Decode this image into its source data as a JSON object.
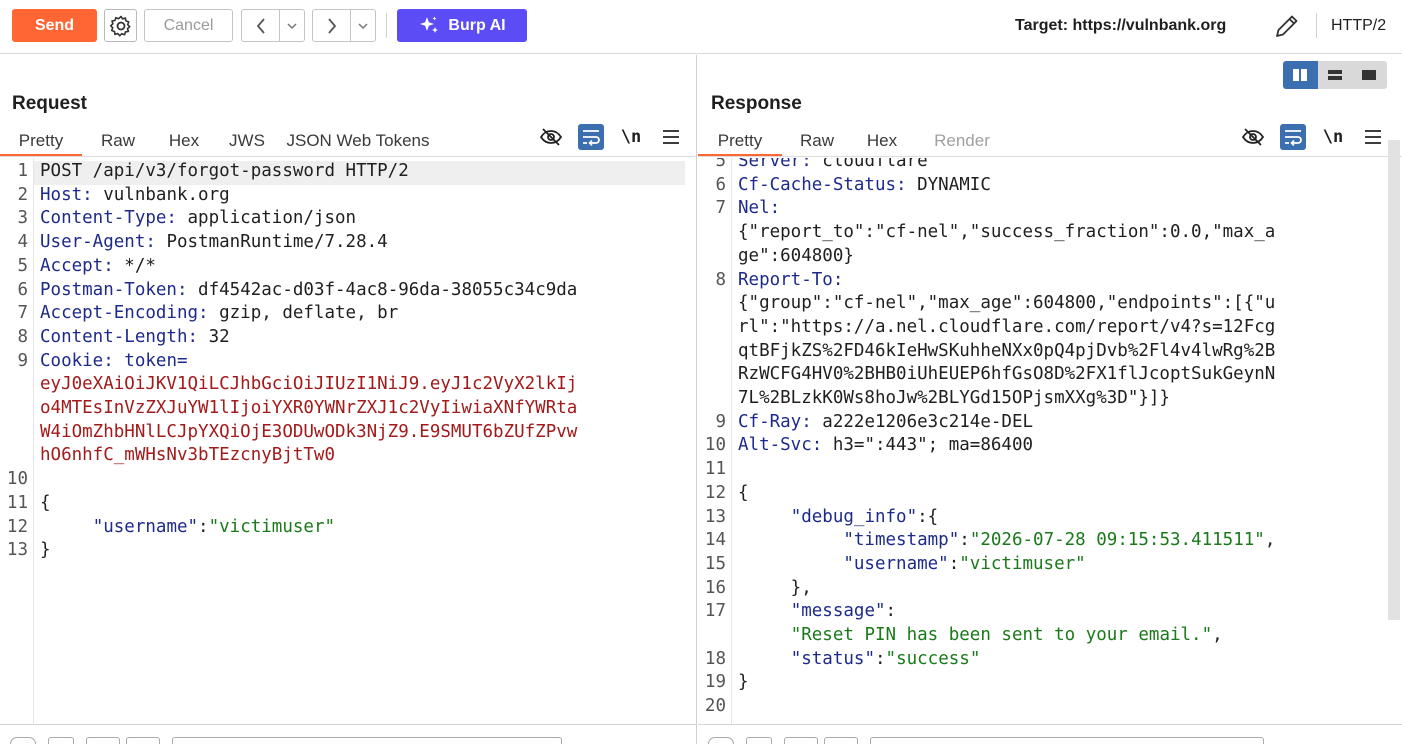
{
  "toolbar": {
    "send_label": "Send",
    "cancel_label": "Cancel",
    "burp_ai_label": "Burp AI",
    "target_text": "Target: https://vulnbank.org",
    "protocol": "HTTP/2",
    "colors": {
      "send": "#ff6633",
      "burp_ai": "#5b4cf5"
    }
  },
  "request": {
    "title": "Request",
    "tabs": [
      "Pretty",
      "Raw",
      "Hex",
      "JWS",
      "JSON Web Tokens"
    ],
    "active_tab": "Pretty",
    "lines": [
      {
        "n": "1",
        "parts": [
          {
            "t": "POST /api/v3/forgot-password HTTP/2",
            "c": ""
          }
        ]
      },
      {
        "n": "2",
        "parts": [
          {
            "t": "Host:",
            "c": "k"
          },
          {
            "t": " vulnbank.org",
            "c": ""
          }
        ]
      },
      {
        "n": "3",
        "parts": [
          {
            "t": "Content-Type:",
            "c": "k"
          },
          {
            "t": " application/json",
            "c": ""
          }
        ]
      },
      {
        "n": "4",
        "parts": [
          {
            "t": "User-Agent:",
            "c": "k"
          },
          {
            "t": " PostmanRuntime/7.28.4",
            "c": ""
          }
        ]
      },
      {
        "n": "5",
        "parts": [
          {
            "t": "Accept:",
            "c": "k"
          },
          {
            "t": " */*",
            "c": ""
          }
        ]
      },
      {
        "n": "6",
        "parts": [
          {
            "t": "Postman-Token:",
            "c": "k"
          },
          {
            "t": " df4542ac-d03f-4ac8-96da-38055c34c9da",
            "c": ""
          }
        ]
      },
      {
        "n": "7",
        "parts": [
          {
            "t": "Accept-Encoding:",
            "c": "k"
          },
          {
            "t": " gzip, deflate, br",
            "c": ""
          }
        ]
      },
      {
        "n": "8",
        "parts": [
          {
            "t": "Content-Length:",
            "c": "k"
          },
          {
            "t": " 32",
            "c": ""
          }
        ]
      },
      {
        "n": "9",
        "parts": [
          {
            "t": "Cookie:",
            "c": "k"
          },
          {
            "t": " token=",
            "c": "k"
          }
        ]
      },
      {
        "n": "",
        "parts": [
          {
            "t": "eyJ0eXAiOiJKV1QiLCJhbGciOiJIUzI1NiJ9.eyJ1c2VyX2lkIj",
            "c": "tok"
          }
        ]
      },
      {
        "n": "",
        "parts": [
          {
            "t": "o4MTEsInVzZXJuYW1lIjoiYXR0YWNrZXJ1c2VyIiwiaXNfYWRta",
            "c": "tok"
          }
        ]
      },
      {
        "n": "",
        "parts": [
          {
            "t": "W4iOmZhbHNlLCJpYXQiOjE3ODUwODk3NjZ9.E9SMUT6bZUfZPvw",
            "c": "tok"
          }
        ]
      },
      {
        "n": "",
        "parts": [
          {
            "t": "hO6nhfC_mWHsNv3bTEzcnyBjtTw0",
            "c": "tok"
          }
        ]
      },
      {
        "n": "10",
        "parts": [
          {
            "t": "",
            "c": ""
          }
        ]
      },
      {
        "n": "11",
        "parts": [
          {
            "t": "{",
            "c": ""
          }
        ]
      },
      {
        "n": "12",
        "parts": [
          {
            "t": "     ",
            "c": ""
          },
          {
            "t": "\"username\"",
            "c": "k"
          },
          {
            "t": ":",
            "c": ""
          },
          {
            "t": "\"victimuser\"",
            "c": "s"
          }
        ]
      },
      {
        "n": "13",
        "parts": [
          {
            "t": "}",
            "c": ""
          }
        ]
      }
    ]
  },
  "response": {
    "title": "Response",
    "tabs": [
      "Pretty",
      "Raw",
      "Hex",
      "Render"
    ],
    "active_tab": "Pretty",
    "lines": [
      {
        "n": "5",
        "parts": [
          {
            "t": "Server:",
            "c": "k"
          },
          {
            "t": " cloudflare",
            "c": ""
          }
        ]
      },
      {
        "n": "6",
        "parts": [
          {
            "t": "Cf-Cache-Status:",
            "c": "k"
          },
          {
            "t": " DYNAMIC",
            "c": ""
          }
        ]
      },
      {
        "n": "7",
        "parts": [
          {
            "t": "Nel:",
            "c": "k"
          }
        ]
      },
      {
        "n": "",
        "parts": [
          {
            "t": "{\"report_to\":\"cf-nel\",\"success_fraction\":0.0,\"max_a",
            "c": ""
          }
        ]
      },
      {
        "n": "",
        "parts": [
          {
            "t": "ge\":604800}",
            "c": ""
          }
        ]
      },
      {
        "n": "8",
        "parts": [
          {
            "t": "Report-To:",
            "c": "k"
          }
        ]
      },
      {
        "n": "",
        "parts": [
          {
            "t": "{\"group\":\"cf-nel\",\"max_age\":604800,\"endpoints\":[{\"u",
            "c": ""
          }
        ]
      },
      {
        "n": "",
        "parts": [
          {
            "t": "rl\":\"https://a.nel.cloudflare.com/report/v4?s=12Fcg",
            "c": ""
          }
        ]
      },
      {
        "n": "",
        "parts": [
          {
            "t": "qtBFjkZS%2FD46kIeHwSKuhheNXx0pQ4pjDvb%2Fl4v4lwRg%2B",
            "c": ""
          }
        ]
      },
      {
        "n": "",
        "parts": [
          {
            "t": "RzWCFG4HV0%2BHB0iUhEUEP6hfGsO8D%2FX1flJcoptSukGeynN",
            "c": ""
          }
        ]
      },
      {
        "n": "",
        "parts": [
          {
            "t": "7L%2BLzkK0Ws8hoJw%2BLYGd15OPjsmXXg%3D\"}]}",
            "c": ""
          }
        ]
      },
      {
        "n": "9",
        "parts": [
          {
            "t": "Cf-Ray:",
            "c": "k"
          },
          {
            "t": " a222e1206e3c214e-DEL",
            "c": ""
          }
        ]
      },
      {
        "n": "10",
        "parts": [
          {
            "t": "Alt-Svc:",
            "c": "k"
          },
          {
            "t": " h3=\":443\"; ma=86400",
            "c": ""
          }
        ]
      },
      {
        "n": "11",
        "parts": [
          {
            "t": "",
            "c": ""
          }
        ]
      },
      {
        "n": "12",
        "parts": [
          {
            "t": "{",
            "c": ""
          }
        ]
      },
      {
        "n": "13",
        "parts": [
          {
            "t": "     ",
            "c": ""
          },
          {
            "t": "\"debug_info\"",
            "c": "k"
          },
          {
            "t": ":{",
            "c": ""
          }
        ]
      },
      {
        "n": "14",
        "parts": [
          {
            "t": "          ",
            "c": ""
          },
          {
            "t": "\"timestamp\"",
            "c": "k"
          },
          {
            "t": ":",
            "c": ""
          },
          {
            "t": "\"2026-07-28 09:15:53.411511\"",
            "c": "s"
          },
          {
            "t": ",",
            "c": ""
          }
        ]
      },
      {
        "n": "15",
        "parts": [
          {
            "t": "          ",
            "c": ""
          },
          {
            "t": "\"username\"",
            "c": "k"
          },
          {
            "t": ":",
            "c": ""
          },
          {
            "t": "\"victimuser\"",
            "c": "s"
          }
        ]
      },
      {
        "n": "16",
        "parts": [
          {
            "t": "     },",
            "c": ""
          }
        ]
      },
      {
        "n": "17",
        "parts": [
          {
            "t": "     ",
            "c": ""
          },
          {
            "t": "\"message\"",
            "c": "k"
          },
          {
            "t": ":",
            "c": ""
          }
        ]
      },
      {
        "n": "",
        "parts": [
          {
            "t": "     ",
            "c": ""
          },
          {
            "t": "\"Reset PIN has been sent to your email.\"",
            "c": "s"
          },
          {
            "t": ",",
            "c": ""
          }
        ]
      },
      {
        "n": "18",
        "parts": [
          {
            "t": "     ",
            "c": ""
          },
          {
            "t": "\"status\"",
            "c": "k"
          },
          {
            "t": ":",
            "c": ""
          },
          {
            "t": "\"success\"",
            "c": "s"
          }
        ]
      },
      {
        "n": "19",
        "parts": [
          {
            "t": "}",
            "c": ""
          }
        ]
      },
      {
        "n": "20",
        "parts": [
          {
            "t": "",
            "c": ""
          }
        ]
      }
    ]
  },
  "icons": {
    "settings": "gear-icon",
    "back": "chevron-left-icon",
    "forward": "chevron-right-icon",
    "ai": "sparkle-icon",
    "edit_target": "pencil-icon",
    "hide": "eye-slash-icon",
    "wrap": "wrap-lines-icon",
    "newline": "newline-icon",
    "menu": "hamburger-icon"
  },
  "newline_glyph": "\\n"
}
